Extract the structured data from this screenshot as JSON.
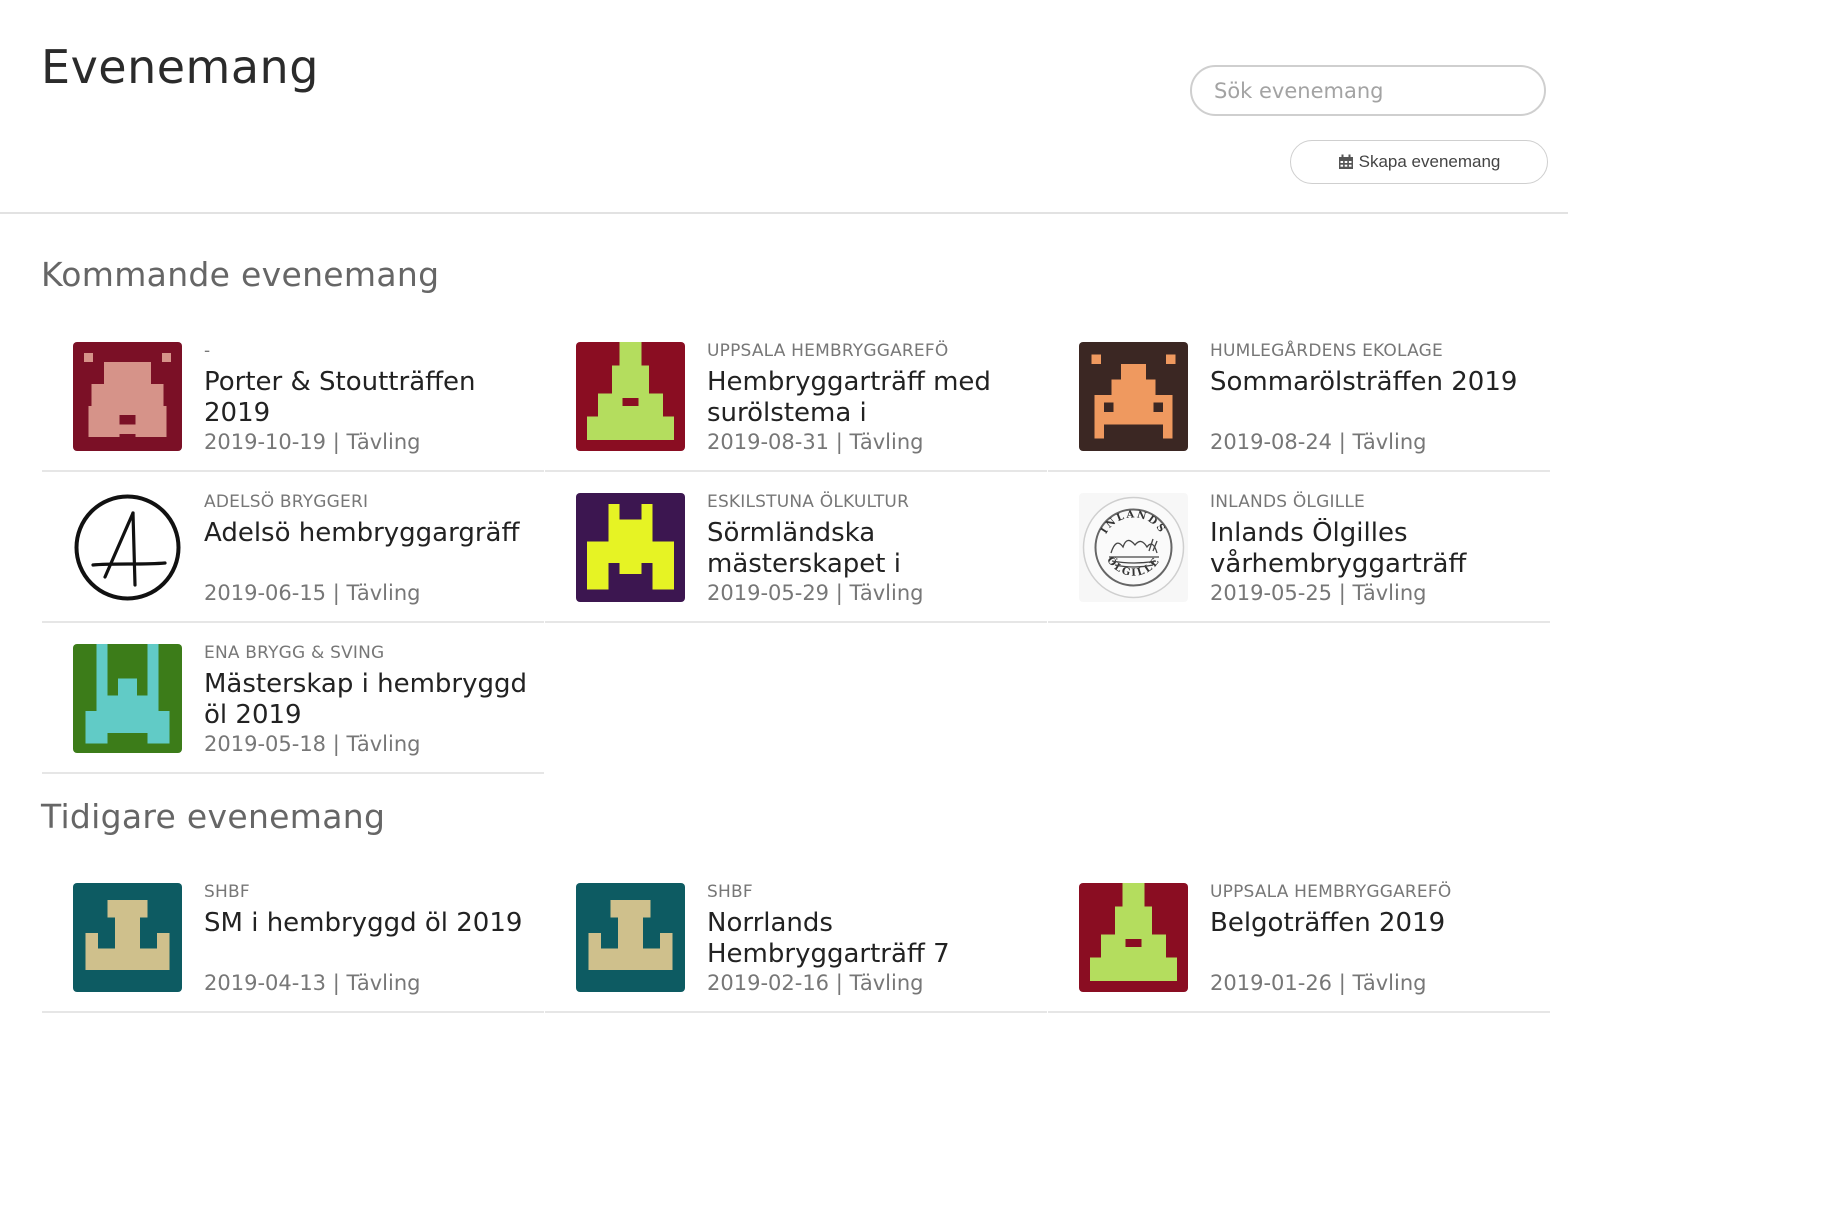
{
  "page": {
    "title": "Evenemang",
    "search_placeholder": "Sök evenemang",
    "create_label": "Skapa evenemang"
  },
  "sections": {
    "upcoming": {
      "title": "Kommande evenemang"
    },
    "past": {
      "title": "Tidigare evenemang"
    }
  },
  "upcoming_events": [
    {
      "org": "-",
      "title": "Porter & Stoutträffen 2019",
      "date": "2019-10-19",
      "type": "Tävling",
      "logo": "porter-logo"
    },
    {
      "org": "UPPSALA HEMBRYGGAREFÖ",
      "title": "Hembryggarträff med surölstema i",
      "date": "2019-08-31",
      "type": "Tävling",
      "logo": "uppsala-logo"
    },
    {
      "org": "HUMLEGÅRDENS EKOLAGE",
      "title": "Sommarölsträffen 2019",
      "date": "2019-08-24",
      "type": "Tävling",
      "logo": "humlegarden-logo"
    },
    {
      "org": "ADELSÖ BRYGGERI",
      "title": "Adelsö hembryggargräff",
      "date": "2019-06-15",
      "type": "Tävling",
      "logo": "adelso-logo"
    },
    {
      "org": "ESKILSTUNA ÖLKULTUR",
      "title": "Sörmländska mästerskapet i",
      "date": "2019-05-29",
      "type": "Tävling",
      "logo": "eskilstuna-logo"
    },
    {
      "org": "INLANDS ÖLGILLE",
      "title": "Inlands Ölgilles vårhembryggarträff",
      "date": "2019-05-25",
      "type": "Tävling",
      "logo": "inlands-logo",
      "logo_text_top": "INLANDS",
      "logo_text_bottom": "ÖLGILLE"
    },
    {
      "org": "ENA BRYGG & SVING",
      "title": "Mästerskap i hembryggd öl 2019",
      "date": "2019-05-18",
      "type": "Tävling",
      "logo": "ena-logo"
    }
  ],
  "past_events": [
    {
      "org": "SHBF",
      "title": "SM i hembryggd öl 2019",
      "date": "2019-04-13",
      "type": "Tävling",
      "logo": "shbf-logo"
    },
    {
      "org": "SHBF",
      "title": "Norrlands Hembryggarträff 7",
      "date": "2019-02-16",
      "type": "Tävling",
      "logo": "shbf-logo"
    },
    {
      "org": "UPPSALA HEMBRYGGAREFÖ",
      "title": "Belgoträffen 2019",
      "date": "2019-01-26",
      "type": "Tävling",
      "logo": "uppsala-logo"
    }
  ],
  "colors": {
    "porter_bg": "#7b1026",
    "porter_fg": "#d69389",
    "uppsala_bg": "#8a0d22",
    "uppsala_fg": "#b4dd5e",
    "humle_bg": "#3b2723",
    "humle_fg": "#ef995f",
    "eskil_bg": "#3c1650",
    "eskil_fg": "#e6f324",
    "ena_bg": "#3c7c19",
    "ena_fg": "#61cbc6",
    "shbf_bg": "#0d5b62",
    "shbf_fg": "#cfc08c"
  }
}
